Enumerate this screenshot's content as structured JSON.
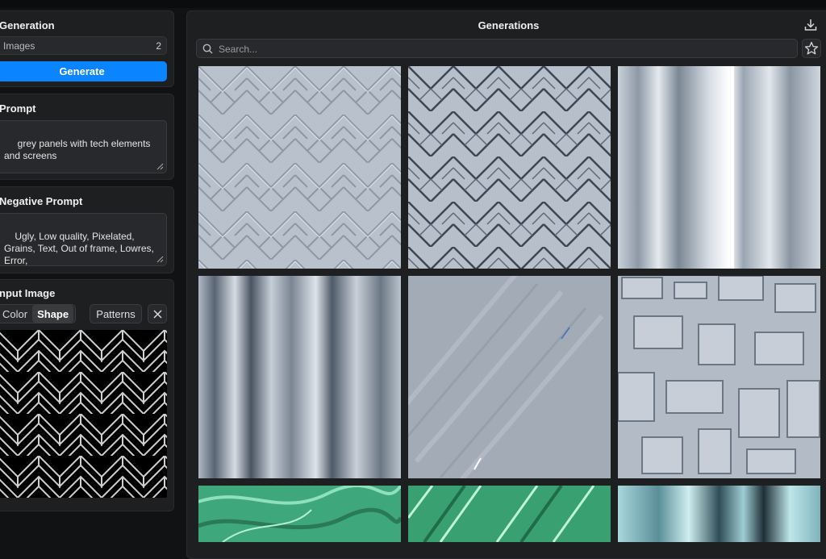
{
  "sidebar": {
    "generation": {
      "title": "Generation",
      "images_label": "Images",
      "images_value": "2",
      "generate_label": "Generate"
    },
    "prompt": {
      "title": "Prompt",
      "value": " grey panels with tech elements\nand screens"
    },
    "negative_prompt": {
      "title": "Negative Prompt",
      "value": "Ugly, Low quality, Pixelated,\nGrains, Text, Out of frame, Lowres,\nError,"
    },
    "input_image": {
      "title": "nput Image",
      "tabs": [
        "Color",
        "Shape"
      ],
      "active_tab": "Shape",
      "patterns_label": "Patterns"
    }
  },
  "main": {
    "title": "Generations",
    "search_placeholder": "Search...",
    "tiles": [
      {
        "style": "herringbone-light"
      },
      {
        "style": "herringbone-dark-lines"
      },
      {
        "style": "vertical-stripes"
      },
      {
        "style": "vertical-stripes-dark"
      },
      {
        "style": "diagonal-smooth"
      },
      {
        "style": "broken-blocks"
      },
      {
        "style": "green-organic"
      },
      {
        "style": "green-diagonal"
      },
      {
        "style": "teal-vertical"
      }
    ]
  },
  "colors": {
    "accent": "#0a84ff",
    "panel": "#1e1f21",
    "background": "#111214"
  }
}
